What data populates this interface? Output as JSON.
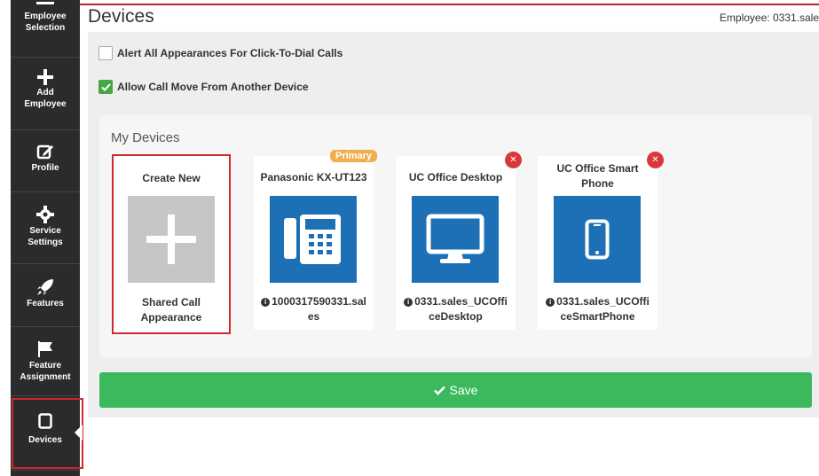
{
  "sidebar": {
    "items": [
      {
        "label": "Employee Selection",
        "icon": "list-icon"
      },
      {
        "label": "Add Employee",
        "icon": "plus-icon"
      },
      {
        "label": "Profile",
        "icon": "edit-icon"
      },
      {
        "label": "Service Settings",
        "icon": "gear-icon"
      },
      {
        "label": "Features",
        "icon": "rocket-icon"
      },
      {
        "label": "Feature Assignment",
        "icon": "flag-icon"
      },
      {
        "label": "Devices",
        "icon": "device-icon"
      }
    ]
  },
  "header": {
    "title": "Devices",
    "employee": "Employee: 0331.sale"
  },
  "options": {
    "alert_all": {
      "label": "Alert All Appearances For Click-To-Dial Calls",
      "checked": false
    },
    "allow_move": {
      "label": "Allow Call Move From Another Device",
      "checked": true
    }
  },
  "my_devices": {
    "title": "My Devices",
    "cards": [
      {
        "title": "Create New",
        "subtitle": "Shared Call Appearance"
      },
      {
        "title": "Panasonic KX-UT123",
        "badge": "Primary",
        "id_line1": "1000317590331.sal",
        "id_line2": "es"
      },
      {
        "title": "UC Office Desktop",
        "id_line1": "0331.sales_UCOffi",
        "id_line2": "ceDesktop"
      },
      {
        "title_line1": "UC Office Smart",
        "title_line2": "Phone",
        "id_line1": "0331.sales_UCOffi",
        "id_line2": "ceSmartPhone"
      }
    ]
  },
  "save": {
    "label": "Save"
  },
  "colors": {
    "save_green": "#3cb95c",
    "device_blue": "#1d6fb6",
    "highlight_red": "#d0282e",
    "badge_orange": "#f0ad4e"
  }
}
